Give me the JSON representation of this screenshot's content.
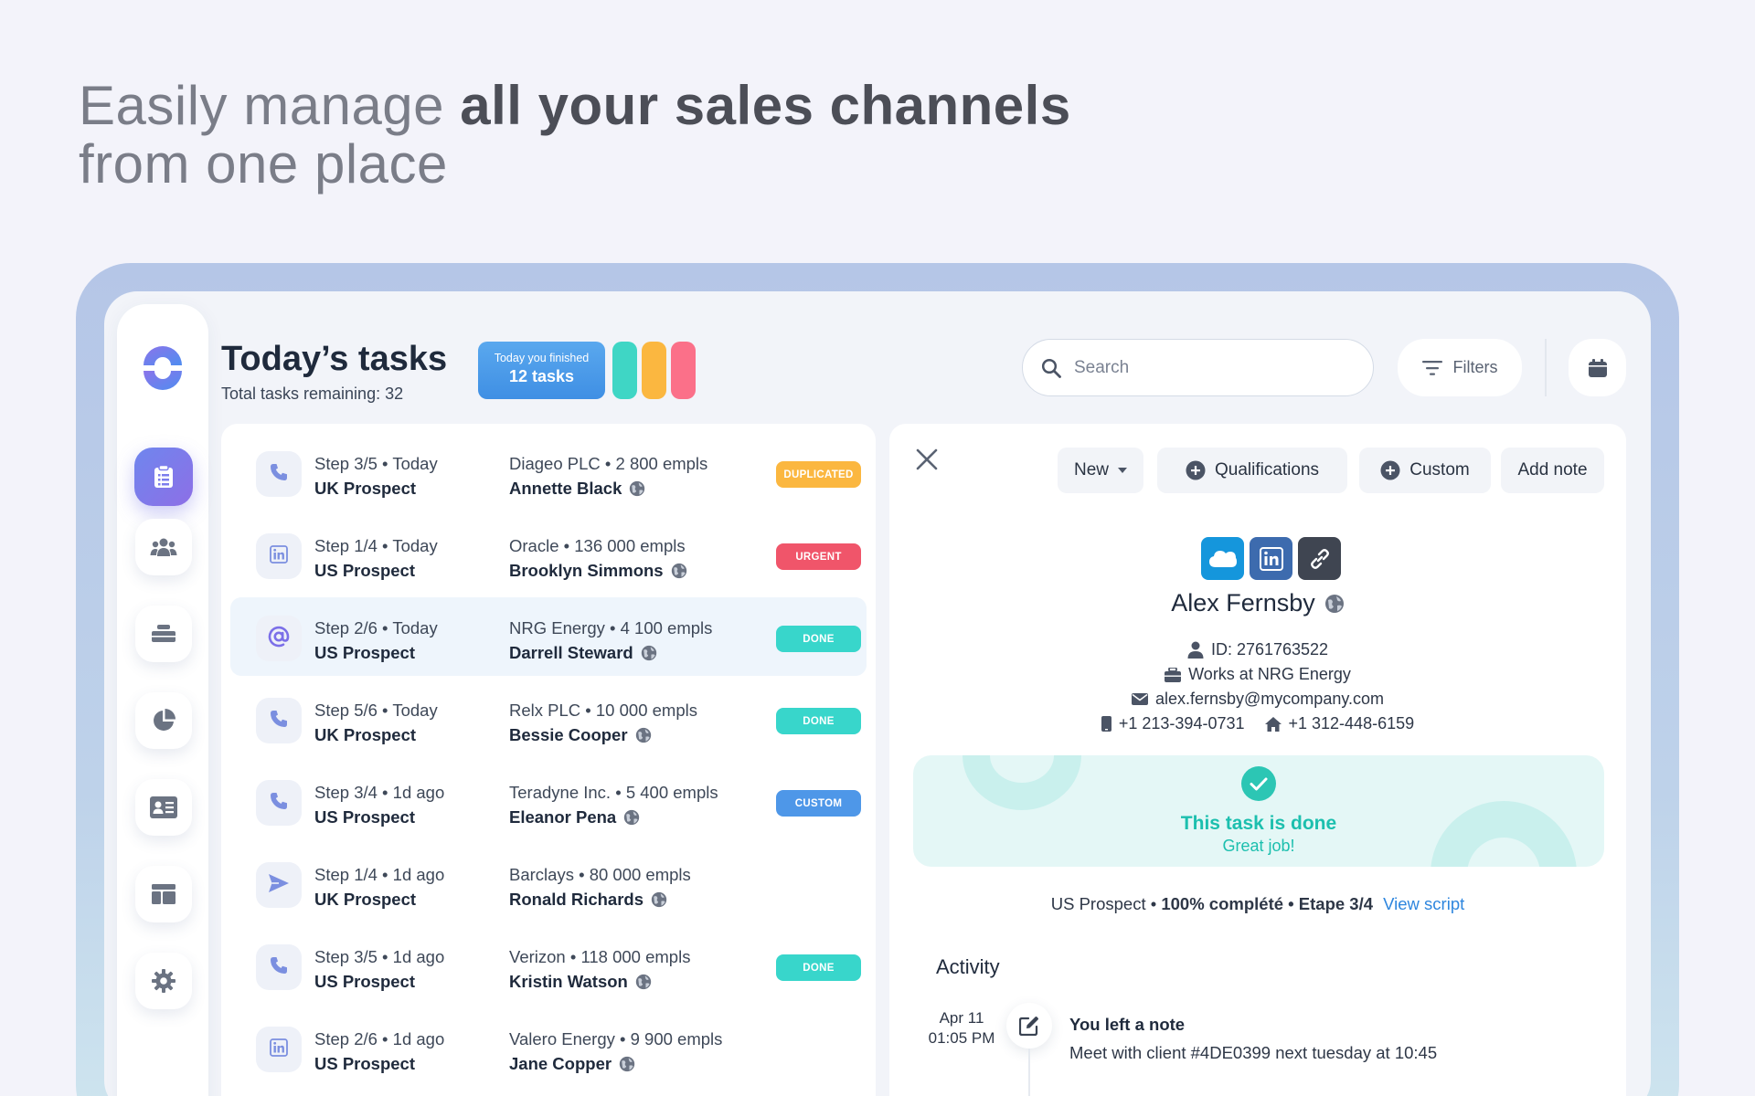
{
  "headline": {
    "part1": "Easily manage ",
    "part2": "all your sales channels",
    "part3": "from one place"
  },
  "header": {
    "title": "Today’s tasks",
    "subtitle": "Total tasks remaining: 32",
    "finished_label": "Today you finished",
    "finished_count": "12 tasks",
    "pill_colors": [
      "#3fd6c5",
      "#fbb740",
      "#fb7089"
    ]
  },
  "search": {
    "placeholder": "Search"
  },
  "filters": {
    "label": "Filters"
  },
  "colors": {
    "accent": "#6f86ee",
    "duplicated": "#fbb740",
    "urgent": "#f0556a",
    "done": "#38d6cb",
    "custom": "#4e97e8"
  },
  "sidebar": {
    "items": [
      {
        "icon": "clipboard-icon",
        "active": true
      },
      {
        "icon": "team-icon"
      },
      {
        "icon": "stack-icon"
      },
      {
        "icon": "pie-chart-icon"
      },
      {
        "icon": "contact-card-icon"
      },
      {
        "icon": "layout-icon"
      },
      {
        "icon": "gear-icon"
      }
    ]
  },
  "tasks": [
    {
      "icon": "phone-icon",
      "step": "Step 3/5 • Today",
      "type": "UK Prospect",
      "company": "Diageo PLC • 2 800 empls",
      "person": "Annette Black",
      "badge": "DUPLICATED",
      "badge_color": "#fbb740"
    },
    {
      "icon": "linkedin-icon",
      "step": "Step 1/4  • Today",
      "type": "US Prospect",
      "company": "Oracle • 136 000 empls",
      "person": "Brooklyn Simmons",
      "badge": "URGENT",
      "badge_color": "#f0556a"
    },
    {
      "icon": "at-icon",
      "step": "Step 2/6 •  Today",
      "type": "US Prospect",
      "company": "NRG Energy   • 4 100 empls",
      "person": "Darrell Steward",
      "badge": "DONE",
      "badge_color": "#38d6cb",
      "highlight": true
    },
    {
      "icon": "phone-icon",
      "step": "Step 5/6  • Today",
      "type": "UK Prospect",
      "company": "Relx PLC • 10 000 empls",
      "person": "Bessie Cooper",
      "badge": "DONE",
      "badge_color": "#38d6cb"
    },
    {
      "icon": "phone-icon",
      "step": "Step 3/4   • 1d ago",
      "type": "US Prospect",
      "company": "Teradyne Inc. • 5 400 empls",
      "person": "Eleanor Pena",
      "badge": "CUSTOM",
      "badge_color": "#4e97e8"
    },
    {
      "icon": "send-icon",
      "step": "Step 1/4   • 1d ago",
      "type": "UK Prospect",
      "company": "Barclays • 80 000 empls",
      "person": "Ronald Richards",
      "badge": "",
      "badge_color": ""
    },
    {
      "icon": "phone-icon",
      "step": "Step 3/5   • 1d ago",
      "type": "US Prospect",
      "company": "Verizon • 118 000 empls",
      "person": "Kristin Watson",
      "badge": "DONE",
      "badge_color": "#38d6cb"
    },
    {
      "icon": "linkedin-icon",
      "step": "Step 2/6  • 1d ago",
      "type": "US Prospect",
      "company": "Valero Energy   • 9 900 empls",
      "person": "Jane Copper",
      "badge": "",
      "badge_color": ""
    }
  ],
  "detail": {
    "status_label": "New",
    "qualifications_label": "Qualifications",
    "custom_label": "Custom",
    "add_note_label": "Add note",
    "name": "Alex Fernsby",
    "id": "ID: 2761763522",
    "works_at": "Works at NRG Energy",
    "email": "alex.fernsby@mycompany.com",
    "mobile": "+1 213-394-0731",
    "home": "+1 312-448-6159",
    "done_title": "This task is done",
    "done_sub": "Great job!",
    "progress_prefix": "US Prospect • ",
    "progress_bold": "100% complété • Etape 3/4",
    "view_script": "View script",
    "activity_heading": "Activity",
    "activity": {
      "date": "Apr 11",
      "time": "01:05 PM",
      "title": "You left a note",
      "text": "Meet with client #4DE0399 next tuesday at 10:45"
    }
  }
}
